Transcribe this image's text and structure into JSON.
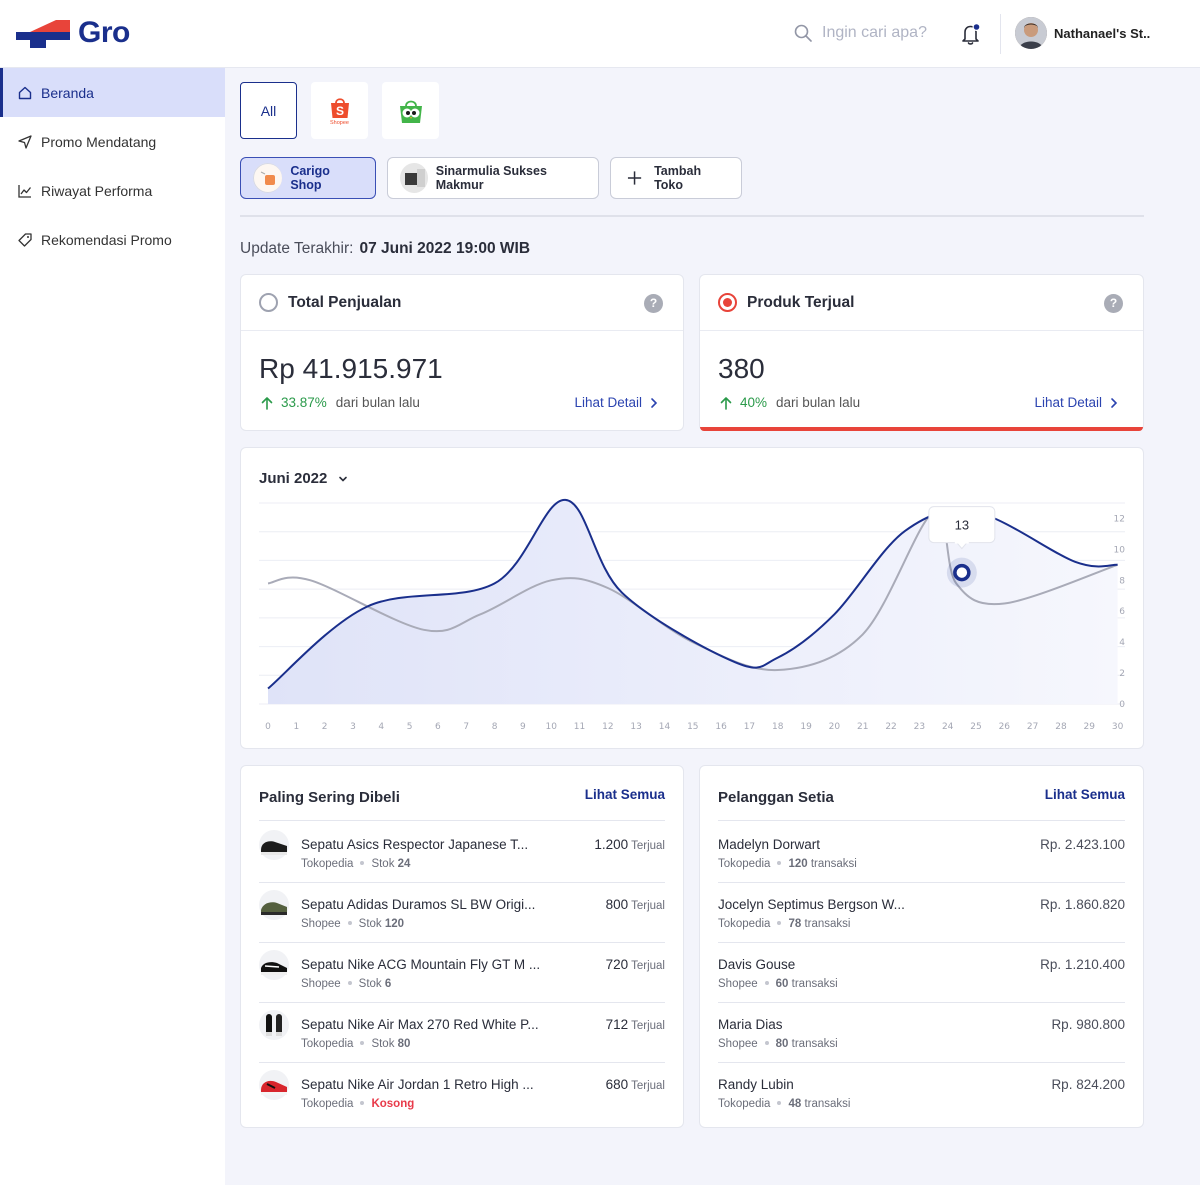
{
  "app": {
    "logo_text": "Gro"
  },
  "header": {
    "search_placeholder": "Ingin cari apa?",
    "user_name": "Nathanael's St.."
  },
  "sidebar": {
    "items": [
      {
        "label": "Beranda",
        "icon": "home-icon",
        "active": true
      },
      {
        "label": "Promo Mendatang",
        "icon": "send-icon",
        "active": false
      },
      {
        "label": "Riwayat Performa",
        "icon": "chart-line-icon",
        "active": false
      },
      {
        "label": "Rekomendasi Promo",
        "icon": "tag-icon",
        "active": false
      }
    ]
  },
  "filters": {
    "all_label": "All",
    "shopee_label": "Shopee"
  },
  "shops": [
    {
      "label": "Carigo Shop",
      "active": true
    },
    {
      "label": "Sinarmulia Sukses Makmur",
      "active": false
    }
  ],
  "add_shop_label": "Tambah Toko",
  "update": {
    "label": "Update Terakhir:",
    "value": "07 Juni 2022 19:00 WIB"
  },
  "kpis": [
    {
      "title": "Total Penjualan",
      "value": "Rp 41.915.971",
      "change": "33.87%",
      "change_label": "dari bulan lalu",
      "link": "Lihat Detail",
      "selected": false
    },
    {
      "title": "Produk Terjual",
      "value": "380",
      "change": "40%",
      "change_label": "dari bulan lalu",
      "link": "Lihat Detail",
      "selected": true
    }
  ],
  "colors": {
    "primary": "#1a2f8c",
    "accent_red": "#e8443a",
    "up_green": "#2a9a4a",
    "secondary_line": "#a9abb8"
  },
  "chart_data": {
    "type": "line",
    "period_label": "Juni 2022",
    "x": [
      0,
      1,
      2,
      3,
      4,
      5,
      6,
      7,
      8,
      9,
      10,
      11,
      12,
      13,
      14,
      15,
      16,
      17,
      18,
      19,
      20,
      21,
      22,
      23,
      24,
      25,
      26,
      27,
      28,
      29,
      30
    ],
    "x_ticks": [
      "0",
      "1",
      "2",
      "3",
      "4",
      "5",
      "6",
      "7",
      "8",
      "9",
      "10",
      "11",
      "12",
      "13",
      "14",
      "15",
      "16",
      "17",
      "18",
      "19",
      "20",
      "21",
      "22",
      "23",
      "24",
      "25",
      "26",
      "27",
      "28",
      "29",
      "30"
    ],
    "y_ticks": [
      "0",
      "2",
      "4",
      "6",
      "8",
      "10",
      "12"
    ],
    "ylim": [
      0,
      13
    ],
    "series": [
      {
        "color": "#1a2f8c",
        "fill": true,
        "points": [
          [
            0,
            1
          ],
          [
            3.5,
            6.3
          ],
          [
            8,
            7.8
          ],
          [
            10.5,
            13.2
          ],
          [
            12.5,
            7.2
          ],
          [
            16.5,
            2.7
          ],
          [
            18,
            3
          ],
          [
            20,
            5.8
          ],
          [
            22.5,
            11.2
          ],
          [
            25,
            12.4
          ],
          [
            28.5,
            9.2
          ],
          [
            30,
            9
          ]
        ]
      },
      {
        "color": "#a9abb8",
        "fill": false,
        "points": [
          [
            0,
            7.8
          ],
          [
            1.5,
            8
          ],
          [
            5.5,
            4.8
          ],
          [
            7.5,
            5.8
          ],
          [
            10,
            8
          ],
          [
            12,
            7.5
          ],
          [
            15,
            4
          ],
          [
            18,
            2.2
          ],
          [
            21,
            4.5
          ],
          [
            23.5,
            12.4
          ],
          [
            24.3,
            7.8
          ],
          [
            26,
            6.5
          ],
          [
            30,
            9
          ]
        ]
      }
    ],
    "highlight": {
      "x": 24.5,
      "y": 8.5,
      "label": "13"
    },
    "grid": true
  },
  "top_products": {
    "title": "Paling Sering Dibeli",
    "link": "Lihat Semua",
    "unit": "Terjual",
    "stock_label": "Stok",
    "items": [
      {
        "name": "Sepatu Asics Respector Japanese T...",
        "store": "Tokopedia",
        "stock": "24",
        "sold": "1.200",
        "empty": false,
        "img": "black-shoe"
      },
      {
        "name": "Sepatu Adidas Duramos SL BW Origi...",
        "store": "Shopee",
        "stock": "120",
        "sold": "800",
        "empty": false,
        "img": "olive-shoe"
      },
      {
        "name": "Sepatu Nike ACG Mountain Fly GT M ...",
        "store": "Shopee",
        "stock": "6",
        "sold": "720",
        "empty": false,
        "img": "black-white-shoe"
      },
      {
        "name": "Sepatu Nike Air Max 270 Red White P...",
        "store": "Tokopedia",
        "stock": "80",
        "sold": "712",
        "empty": false,
        "img": "pair-shoe"
      },
      {
        "name": "Sepatu Nike Air Jordan 1 Retro High ...",
        "store": "Tokopedia",
        "stock": "Kosong",
        "sold": "680",
        "empty": true,
        "img": "red-shoe"
      }
    ]
  },
  "loyal_customers": {
    "title": "Pelanggan Setia",
    "link": "Lihat Semua",
    "tx_label": "transaksi",
    "items": [
      {
        "name": "Madelyn Dorwart",
        "store": "Tokopedia",
        "tx": "120",
        "amount": "Rp. 2.423.100"
      },
      {
        "name": "Jocelyn Septimus Bergson  W...",
        "store": "Tokopedia",
        "tx": "78",
        "amount": "Rp. 1.860.820"
      },
      {
        "name": "Davis Gouse",
        "store": "Shopee",
        "tx": "60",
        "amount": "Rp. 1.210.400"
      },
      {
        "name": "Maria Dias",
        "store": "Shopee",
        "tx": "80",
        "amount": "Rp. 980.800"
      },
      {
        "name": "Randy Lubin",
        "store": "Tokopedia",
        "tx": "48",
        "amount": "Rp. 824.200"
      }
    ]
  }
}
